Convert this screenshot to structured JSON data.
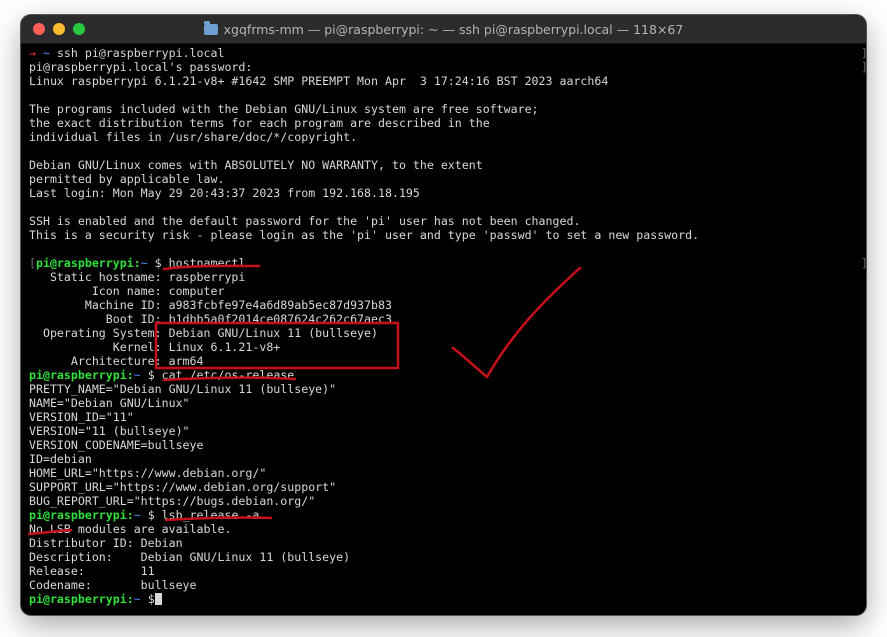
{
  "window": {
    "title": "xgqfrms-mm — pi@raspberrypi: ~ — ssh pi@raspberrypi.local — 118×67"
  },
  "prompt": {
    "user_host": "pi@raspberrypi",
    "path": "~",
    "symbol": "$"
  },
  "lines": {
    "l1": {
      "arrow": "→",
      "tilde": "~",
      "cmd": "ssh pi@raspberrypi.local"
    },
    "l2": "pi@raspberrypi.local's password:",
    "l3": "Linux raspberrypi 6.1.21-v8+ #1642 SMP PREEMPT Mon Apr  3 17:24:16 BST 2023 aarch64",
    "l5": "The programs included with the Debian GNU/Linux system are free software;",
    "l6": "the exact distribution terms for each program are described in the",
    "l7": "individual files in /usr/share/doc/*/copyright.",
    "l9": "Debian GNU/Linux comes with ABSOLUTELY NO WARRANTY, to the extent",
    "l10": "permitted by applicable law.",
    "l11": "Last login: Mon May 29 20:43:37 2023 from 192.168.18.195",
    "l13": "SSH is enabled and the default password for the 'pi' user has not been changed.",
    "l14": "This is a security risk - please login as the 'pi' user and type 'passwd' to set a new password.",
    "cmd1": "hostnamectl",
    "h1": "   Static hostname: raspberrypi",
    "h2": "         Icon name: computer",
    "h3": "        Machine ID: a983fcbfe97e4a6d89ab5ec87d937b83",
    "h4": "           Boot ID: b1dbb5a0f2014ce087624c262c67aec3",
    "h5": "  Operating System: Debian GNU/Linux 11 (bullseye)",
    "h6": "            Kernel: Linux 6.1.21-v8+",
    "h7": "      Architecture: arm64",
    "cmd2": "cat /etc/os-release",
    "o1": "PRETTY_NAME=\"Debian GNU/Linux 11 (bullseye)\"",
    "o2": "NAME=\"Debian GNU/Linux\"",
    "o3": "VERSION_ID=\"11\"",
    "o4": "VERSION=\"11 (bullseye)\"",
    "o5": "VERSION_CODENAME=bullseye",
    "o6": "ID=debian",
    "o7": "HOME_URL=\"https://www.debian.org/\"",
    "o8": "SUPPORT_URL=\"https://www.debian.org/support\"",
    "o9": "BUG_REPORT_URL=\"https://bugs.debian.org/\"",
    "cmd3": "lsb_release -a",
    "s1": "No LSB modules are available.",
    "s2": "Distributor ID: Debian",
    "s3": "Description:    Debian GNU/Linux 11 (bullseye)",
    "s4": "Release:        11",
    "s5": "Codename:       bullseye"
  },
  "markers": {
    "left": "[",
    "right": "]"
  },
  "colors": {
    "prompt_green": "#2fe03b",
    "path_blue": "#4e8cff",
    "annotation_red": "#c8101a",
    "terminal_bg": "#000000"
  }
}
